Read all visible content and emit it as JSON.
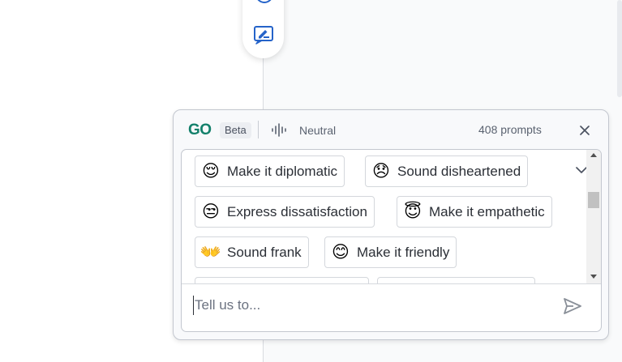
{
  "panel": {
    "logo": "GO",
    "badge": "Beta",
    "tone": "Neutral",
    "prompts_count": "408 prompts"
  },
  "chips": [
    {
      "emoji": "😌",
      "label": "Make it diplomatic"
    },
    {
      "emoji": "😞",
      "label": "Sound disheartened"
    },
    {
      "emoji": "😒",
      "label": "Express dissatisfaction"
    },
    {
      "emoji": "😇",
      "label": "Make it empathetic"
    },
    {
      "emoji": "👐",
      "label": "Sound frank"
    },
    {
      "emoji": "😊",
      "label": "Make it friendly"
    }
  ],
  "input": {
    "placeholder": "Tell us to..."
  },
  "icons": {
    "close": "close-icon",
    "send": "send-icon",
    "chevron": "chevron-down-icon",
    "tone": "sound-wave-icon",
    "edit": "edit-note-icon"
  },
  "colors": {
    "brand": "#13806b",
    "accent": "#2563c9"
  }
}
